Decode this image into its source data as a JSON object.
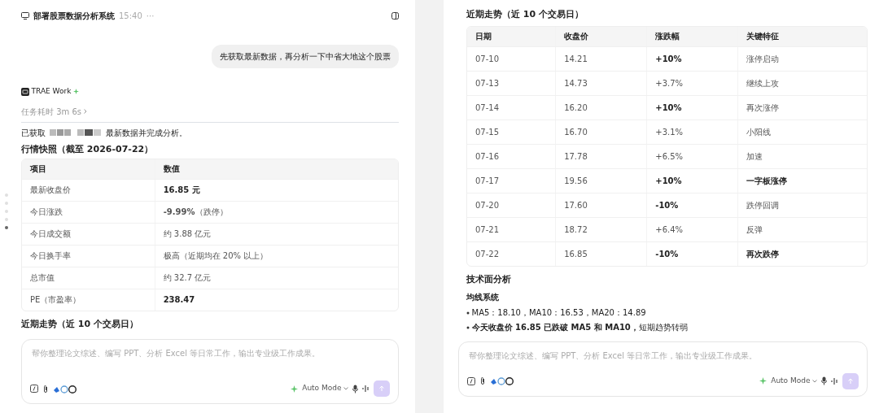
{
  "left_panel": {
    "header": {
      "title": "部署股票数据分析系统",
      "time": "15:40",
      "more": "···"
    },
    "nav_dots": [
      {
        "selected": false
      },
      {
        "selected": false
      },
      {
        "selected": false
      },
      {
        "selected": false
      },
      {
        "selected": true
      }
    ],
    "user_message": "先获取最新数据，再分析一下中省大地这个股票",
    "assistant": {
      "name": "TRAE Work",
      "duration": "任务耗时 3m 6s",
      "summary_prefix": "已获取",
      "summary_suffix": "最新数据并完成分析。"
    },
    "snapshot": {
      "title": "行情快照（截至 2026-07-22）",
      "columns": [
        "项目",
        "数值"
      ],
      "rows": [
        {
          "cells": [
            {
              "text": "最新收盘价",
              "bold": false
            },
            {
              "text": "16.85 元",
              "bold": true
            }
          ]
        },
        {
          "cells": [
            {
              "text": "今日涨跌",
              "bold": false
            },
            {
              "text": "**-9.99%**（跌停）",
              "bold": false
            }
          ]
        },
        {
          "cells": [
            {
              "text": "今日成交额",
              "bold": false
            },
            {
              "text": "约 3.88 亿元",
              "bold": false
            }
          ]
        },
        {
          "cells": [
            {
              "text": "今日换手率",
              "bold": false
            },
            {
              "text": "极高（近期均在 20% 以上）",
              "bold": false
            }
          ]
        },
        {
          "cells": [
            {
              "text": "总市值",
              "bold": false
            },
            {
              "text": "约 32.7 亿元",
              "bold": false
            }
          ]
        },
        {
          "cells": [
            {
              "text": "PE（市盈率）",
              "bold": false
            },
            {
              "text": "238.47",
              "bold": true
            }
          ]
        }
      ]
    },
    "next_heading": "近期走势（近 10 个交易日）",
    "composer": {
      "placeholder": "帮你整理论文综述、编写 PPT、分析 Excel 等日常工作，输出专业级工作成果。",
      "mode": "Auto Mode"
    }
  },
  "right_panel": {
    "trend": {
      "title": "近期走势（近 10 个交易日）",
      "columns": [
        "日期",
        "收盘价",
        "涨跌幅",
        "关键特征"
      ],
      "rows": [
        {
          "cells": [
            {
              "text": "07-10",
              "bold": false
            },
            {
              "text": "14.21",
              "bold": false
            },
            {
              "text": "+10%",
              "bold": true
            },
            {
              "text": "涨停启动",
              "bold": false
            }
          ]
        },
        {
          "cells": [
            {
              "text": "07-13",
              "bold": false
            },
            {
              "text": "14.73",
              "bold": false
            },
            {
              "text": "+3.7%",
              "bold": false
            },
            {
              "text": "继续上攻",
              "bold": false
            }
          ]
        },
        {
          "cells": [
            {
              "text": "07-14",
              "bold": false
            },
            {
              "text": "16.20",
              "bold": false
            },
            {
              "text": "+10%",
              "bold": true
            },
            {
              "text": "再次涨停",
              "bold": false
            }
          ]
        },
        {
          "cells": [
            {
              "text": "07-15",
              "bold": false
            },
            {
              "text": "16.70",
              "bold": false
            },
            {
              "text": "+3.1%",
              "bold": false
            },
            {
              "text": "小阳线",
              "bold": false
            }
          ]
        },
        {
          "cells": [
            {
              "text": "07-16",
              "bold": false
            },
            {
              "text": "17.78",
              "bold": false
            },
            {
              "text": "+6.5%",
              "bold": false
            },
            {
              "text": "加速",
              "bold": false
            }
          ]
        },
        {
          "cells": [
            {
              "text": "07-17",
              "bold": false
            },
            {
              "text": "19.56",
              "bold": false
            },
            {
              "text": "+10%",
              "bold": true
            },
            {
              "text": "一字板涨停",
              "bold": true
            }
          ]
        },
        {
          "cells": [
            {
              "text": "07-20",
              "bold": false
            },
            {
              "text": "17.60",
              "bold": false
            },
            {
              "text": "-10%",
              "bold": true
            },
            {
              "text": "跌停回调",
              "bold": false
            }
          ]
        },
        {
          "cells": [
            {
              "text": "07-21",
              "bold": false
            },
            {
              "text": "18.72",
              "bold": false
            },
            {
              "text": "+6.4%",
              "bold": false
            },
            {
              "text": "反弹",
              "bold": false
            }
          ]
        },
        {
          "cells": [
            {
              "text": "07-22",
              "bold": false
            },
            {
              "text": "16.85",
              "bold": false
            },
            {
              "text": "-10%",
              "bold": true
            },
            {
              "text": "再次跌停",
              "bold": true
            }
          ]
        }
      ]
    },
    "analysis_heading": "技术面分析",
    "sub_heading": "均线系统",
    "bullets": [
      "MA5：18.10，MA10：16.53，MA20：14.89",
      "**今天收盘价 16.85 已跌破 MA5 和 MA10，**短期趋势转弱"
    ],
    "composer": {
      "placeholder": "帮你整理论文综述、编写 PPT、分析 Excel 等日常工作，输出专业级工作成果。",
      "mode": "Auto Mode"
    }
  }
}
